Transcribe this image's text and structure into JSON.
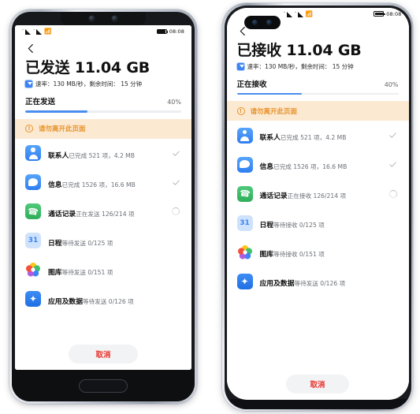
{
  "phones": [
    {
      "id": "sender",
      "model_style": "notch-home-button",
      "status_bar": {
        "signal": "signal-bars",
        "wifi": "wifi-icon",
        "battery": "battery-full-icon",
        "time": "08:08"
      },
      "back_icon": "back-arrow-icon",
      "title": "已发送 11.04 GB",
      "speed_icon": "speed-badge-icon",
      "speed_text": "速率：130 MB/秒，剩余时间： 15 分钟",
      "progress_label": "正在发送",
      "progress_percent": "40%",
      "progress_value": 40,
      "warning_icon": "warning-exclamation-icon",
      "warning_text": "请勿离开此页面",
      "items": [
        {
          "icon": "contacts-icon",
          "name": "联系人",
          "sub": "已完成 521 项，4.2 MB",
          "status": "check"
        },
        {
          "icon": "messages-icon",
          "name": "信息",
          "sub": "已完成 1526 项，16.6 MB",
          "status": "check"
        },
        {
          "icon": "calllog-icon",
          "name": "通话记录",
          "sub": "正在发送 126/214 项",
          "status": "spinner"
        },
        {
          "icon": "calendar-icon",
          "name": "日程",
          "sub": "等待发送 0/125 项",
          "status": "none"
        },
        {
          "icon": "gallery-icon",
          "name": "图库",
          "sub": "等待发送 0/151 项",
          "status": "none"
        },
        {
          "icon": "apps-data-icon",
          "name": "应用及数据",
          "sub": "等待发送 0/126 项",
          "status": "none"
        }
      ],
      "cancel_label": "取消"
    },
    {
      "id": "receiver",
      "model_style": "punch-hole-curved",
      "status_bar": {
        "signal": "signal-bars",
        "wifi": "wifi-icon",
        "battery": "battery-full-icon",
        "time": "08:08"
      },
      "back_icon": "back-arrow-icon",
      "title": "已接收 11.04 GB",
      "speed_icon": "speed-badge-icon",
      "speed_text": "速率：130 MB/秒，剩余时间： 15 分钟",
      "progress_label": "正在接收",
      "progress_percent": "40%",
      "progress_value": 40,
      "warning_icon": "warning-exclamation-icon",
      "warning_text": "请勿离开此页面",
      "items": [
        {
          "icon": "contacts-icon",
          "name": "联系人",
          "sub": "已完成 521 项，4.2 MB",
          "status": "check"
        },
        {
          "icon": "messages-icon",
          "name": "信息",
          "sub": "已完成 1526 项，16.6 MB",
          "status": "check"
        },
        {
          "icon": "calllog-icon",
          "name": "通话记录",
          "sub": "正在接收 126/214 项",
          "status": "spinner"
        },
        {
          "icon": "calendar-icon",
          "name": "日程",
          "sub": "等待接收 0/125 项",
          "status": "none"
        },
        {
          "icon": "gallery-icon",
          "name": "图库",
          "sub": "等待接收 0/151 项",
          "status": "none"
        },
        {
          "icon": "apps-data-icon",
          "name": "应用及数据",
          "sub": "等待发送 0/126 项",
          "status": "none"
        }
      ],
      "cancel_label": "取消"
    }
  ],
  "colors": {
    "progress_blue": "#4a8df0",
    "warning_bg": "#fbe9d2",
    "warning_text": "#e8932c",
    "cancel_red": "#e8312a",
    "contacts_blue": "#2f7ef0",
    "call_green": "#2fae59",
    "calendar_bg": "#cfe2fb"
  }
}
